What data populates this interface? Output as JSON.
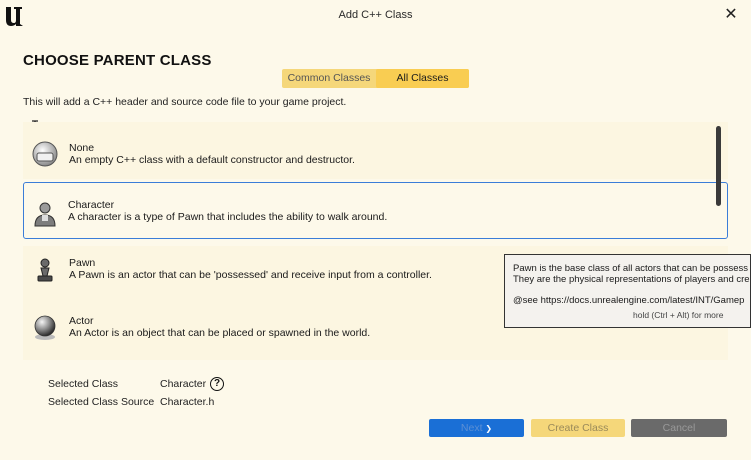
{
  "window": {
    "title": "Add C++ Class",
    "close_glyph": "✕"
  },
  "page": {
    "heading": "CHOOSE PARENT CLASS",
    "description": "This will add a C++ header and source code file to your game project."
  },
  "tabs": [
    {
      "label": "Common Classes",
      "active": false
    },
    {
      "label": "All Classes",
      "active": true
    }
  ],
  "classes": [
    {
      "name": "None",
      "description": "An empty C++ class with a default constructor and destructor.",
      "icon": "none-class-icon",
      "selected": false
    },
    {
      "name": "Character",
      "description": "A character is a type of Pawn that includes the ability to walk around.",
      "icon": "character-icon",
      "selected": true
    },
    {
      "name": "Pawn",
      "description": "A Pawn is an actor that can be 'possessed' and receive input from a controller.",
      "icon": "pawn-icon",
      "selected": false
    },
    {
      "name": "Actor",
      "description": "An Actor is an object that can be placed or spawned in the world.",
      "icon": "actor-icon",
      "selected": false
    }
  ],
  "tooltip": {
    "line1": "Pawn is the base class of all actors that can be possess",
    "line2": "They are the physical representations of players and cre",
    "line3": "@see https://docs.unrealengine.com/latest/INT/Gamep",
    "hint": "hold (Ctrl + Alt) for more"
  },
  "selection": {
    "class_label": "Selected Class",
    "class_value": "Character",
    "source_label": "Selected Class Source",
    "source_value": "Character.h",
    "help_glyph": "?"
  },
  "buttons": {
    "next": "Next",
    "next_glyph": "❯",
    "create": "Create Class",
    "cancel": "Cancel"
  },
  "colors": {
    "background": "#fdf9ea",
    "accent_yellow": "#f9cd52",
    "selection_border": "#3b7dd8",
    "next_button": "#1a6fd6"
  }
}
